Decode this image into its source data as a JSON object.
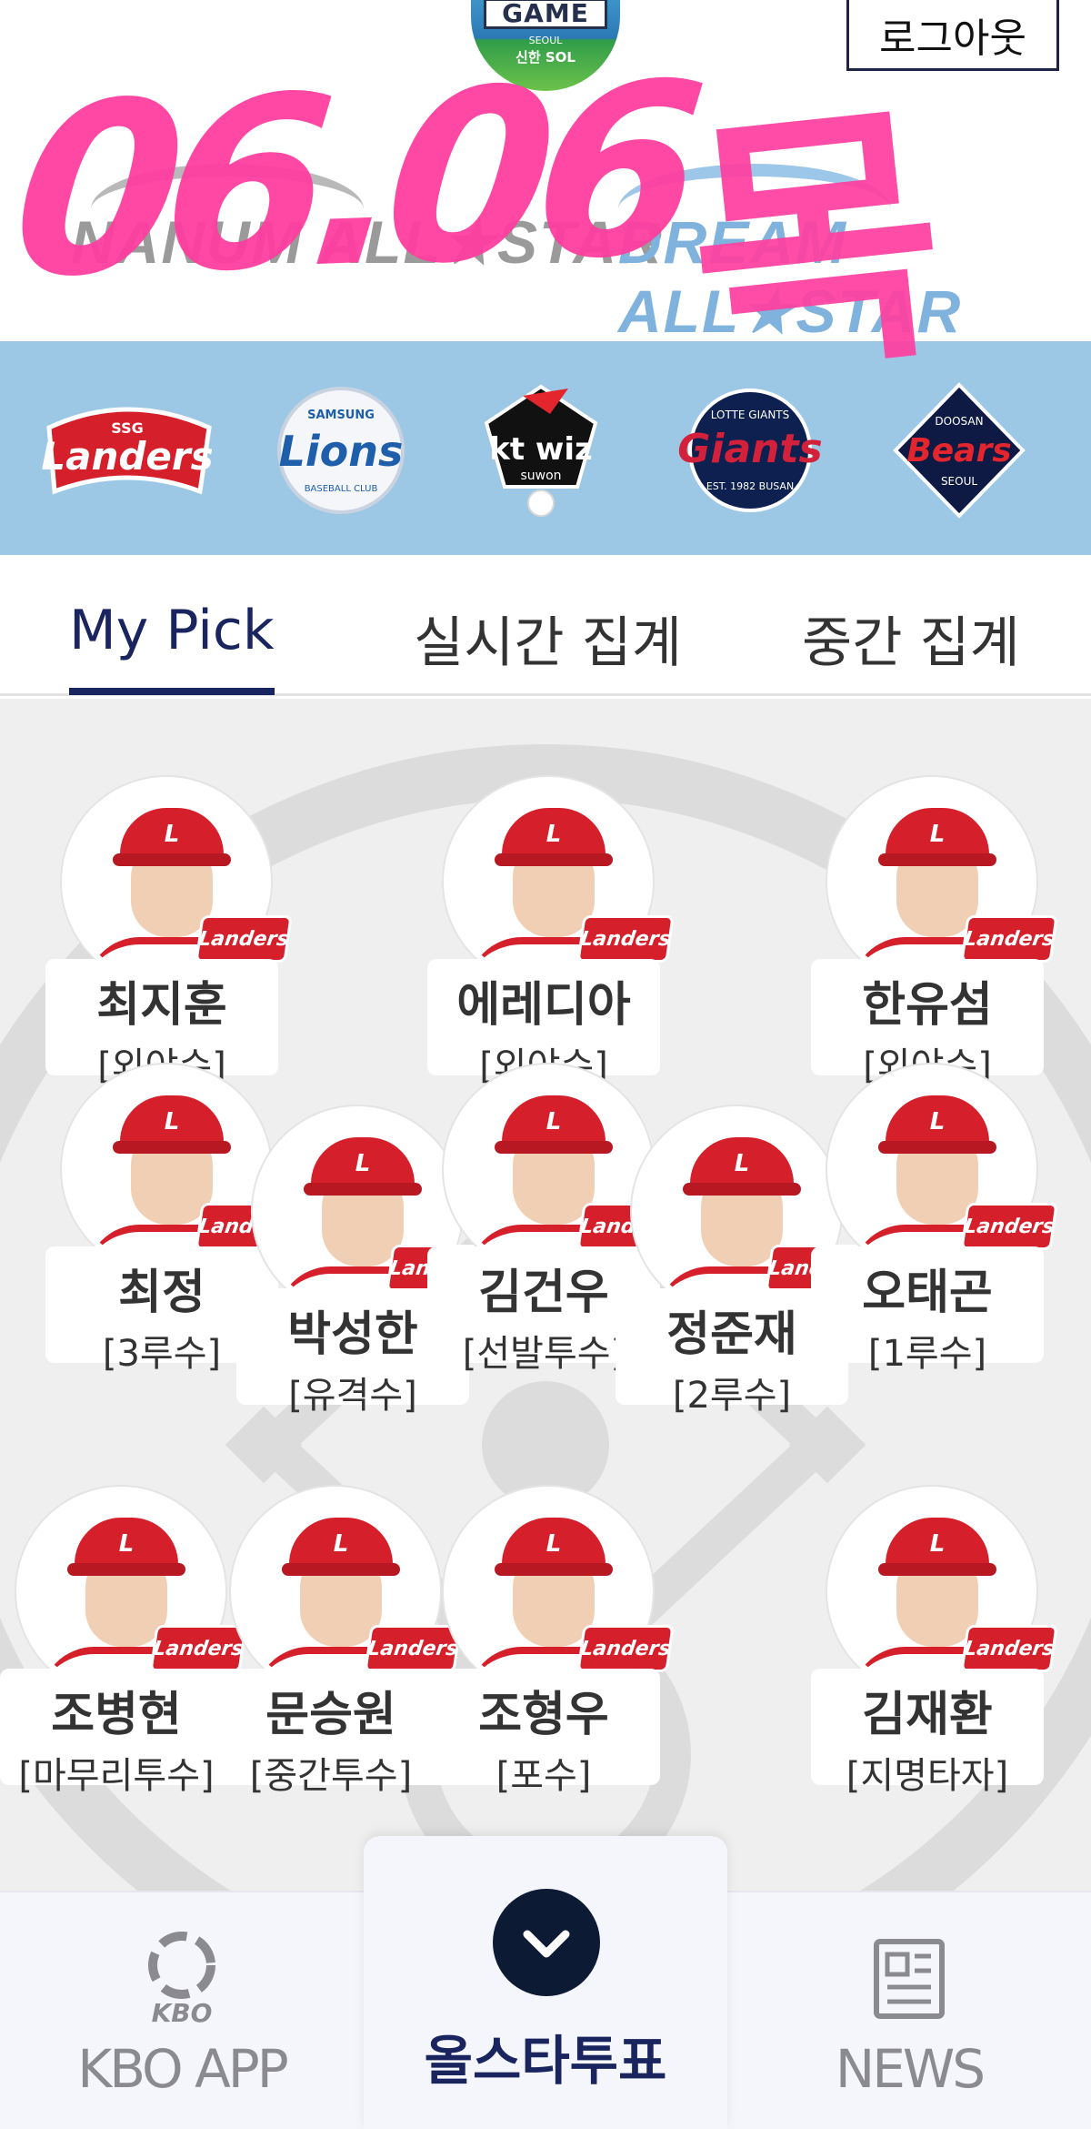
{
  "header": {
    "event_logo": {
      "title": "GAME",
      "subtitle": "SEOUL",
      "sponsor": "신한 SOL"
    },
    "logout_label": "로그아웃",
    "nanum_label": "NANUM ALL★STAR",
    "dream_label": "DREAM ALL★STAR",
    "handwriting": {
      "date": "06.06",
      "day": "목"
    }
  },
  "teams": [
    {
      "name": "Landers",
      "top_text": "SSG",
      "color": "#d51f2a"
    },
    {
      "name": "Lions",
      "top_text": "SAMSUNG",
      "bottom_text": "BASEBALL CLUB",
      "color": "#1e5eab"
    },
    {
      "name": "kt wiz",
      "bottom_text": "suwon",
      "color": "#111111"
    },
    {
      "name": "Giants",
      "top_text": "LOTTE GIANTS",
      "bottom_text": "EST. 1982 BUSAN",
      "color": "#d3203b"
    },
    {
      "name": "Bears",
      "top_text": "DOOSAN",
      "bottom_text": "SEOUL",
      "color": "#0e1a44"
    }
  ],
  "tabs": [
    {
      "label": "My Pick",
      "active": true
    },
    {
      "label": "실시간 집계",
      "active": false
    },
    {
      "label": "중간 집계",
      "active": false
    }
  ],
  "players": [
    {
      "name": "최지훈",
      "position": "[외야수]",
      "team": "Landers"
    },
    {
      "name": "에레디아",
      "position": "[외야수]",
      "team": "Landers"
    },
    {
      "name": "한유섬",
      "position": "[외야수]",
      "team": "Landers"
    },
    {
      "name": "최정",
      "position": "[3루수]",
      "team": "Landers"
    },
    {
      "name": "박성한",
      "position": "[유격수]",
      "team": "Landers"
    },
    {
      "name": "김건우",
      "position": "[선발투수]",
      "team": "Landers"
    },
    {
      "name": "정준재",
      "position": "[2루수]",
      "team": "Landers"
    },
    {
      "name": "오태곤",
      "position": "[1루수]",
      "team": "Landers"
    },
    {
      "name": "조병현",
      "position": "[마무리투수]",
      "team": "Landers"
    },
    {
      "name": "문승원",
      "position": "[중간투수]",
      "team": "Landers"
    },
    {
      "name": "조형우",
      "position": "[포수]",
      "team": "Landers"
    },
    {
      "name": "김재환",
      "position": "[지명타자]",
      "team": "Landers"
    }
  ],
  "badge_text": "Landers",
  "bottom_nav": {
    "kbo_app_label": "KBO APP",
    "kbo_logo_text": "KBO",
    "vote_label": "올스타투표",
    "news_label": "NEWS"
  },
  "colors": {
    "accent": "#1a2560",
    "team_strip": "#9dc8e5",
    "scribble": "#ff3ea0",
    "vote_circle": "#0d1a33"
  }
}
